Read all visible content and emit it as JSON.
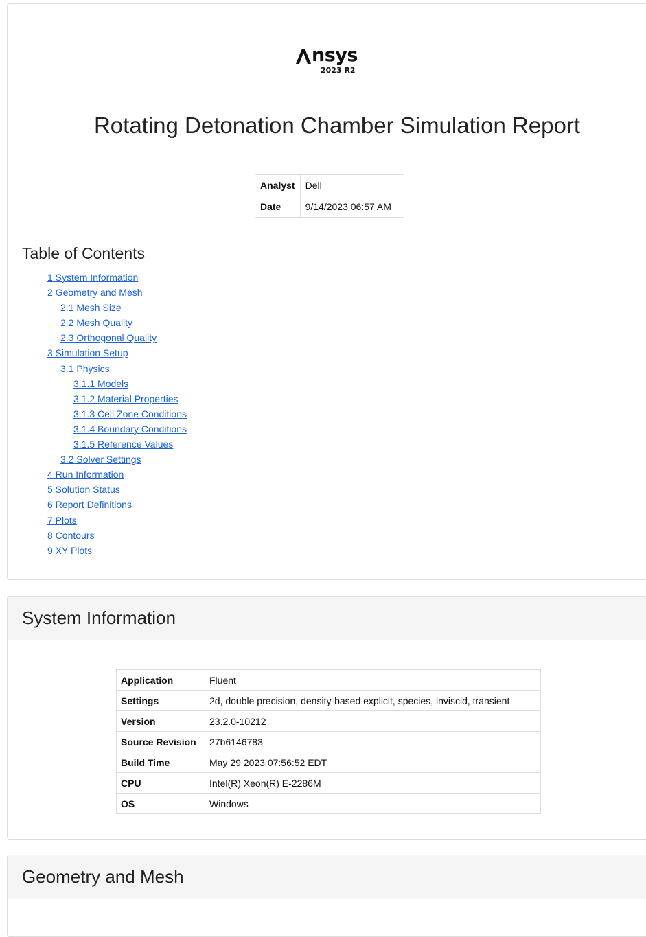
{
  "logo": {
    "brand": "Ansys",
    "version": "2023 R2"
  },
  "report": {
    "title": "Rotating Detonation Chamber Simulation Report",
    "meta": [
      {
        "label": "Analyst",
        "value": "Dell"
      },
      {
        "label": "Date",
        "value": "9/14/2023 06:57 AM"
      }
    ]
  },
  "toc": {
    "title": "Table of Contents",
    "items": [
      {
        "label": "1 System Information",
        "level": 1
      },
      {
        "label": "2 Geometry and Mesh",
        "level": 1
      },
      {
        "label": "2.1 Mesh Size",
        "level": 2
      },
      {
        "label": "2.2 Mesh Quality",
        "level": 2
      },
      {
        "label": "2.3 Orthogonal Quality",
        "level": 2
      },
      {
        "label": "3 Simulation Setup",
        "level": 1
      },
      {
        "label": "3.1 Physics",
        "level": 2
      },
      {
        "label": "3.1.1 Models",
        "level": 3
      },
      {
        "label": "3.1.2 Material Properties",
        "level": 3
      },
      {
        "label": "3.1.3 Cell Zone Conditions",
        "level": 3
      },
      {
        "label": "3.1.4 Boundary Conditions",
        "level": 3
      },
      {
        "label": "3.1.5 Reference Values",
        "level": 3
      },
      {
        "label": "3.2 Solver Settings",
        "level": 2
      },
      {
        "label": "4 Run Information",
        "level": 1
      },
      {
        "label": "5 Solution Status",
        "level": 1
      },
      {
        "label": "6 Report Definitions",
        "level": 1
      },
      {
        "label": "7 Plots",
        "level": 1
      },
      {
        "label": "8 Contours",
        "level": 1
      },
      {
        "label": "9 XY Plots",
        "level": 1
      }
    ]
  },
  "system_info": {
    "heading": "System Information",
    "rows": [
      {
        "label": "Application",
        "value": "Fluent"
      },
      {
        "label": "Settings",
        "value": "2d, double precision, density-based explicit, species, inviscid, transient"
      },
      {
        "label": "Version",
        "value": "23.2.0-10212"
      },
      {
        "label": "Source Revision",
        "value": "27b6146783"
      },
      {
        "label": "Build Time",
        "value": "May 29 2023 07:56:52 EDT"
      },
      {
        "label": "CPU",
        "value": "Intel(R) Xeon(R) E-2286M"
      },
      {
        "label": "OS",
        "value": "Windows"
      }
    ]
  },
  "geometry": {
    "heading": "Geometry and Mesh"
  },
  "colors": {
    "link": "#1a63d8",
    "panel_heading_bg": "#f5f5f5",
    "border": "#dcdcdc"
  }
}
